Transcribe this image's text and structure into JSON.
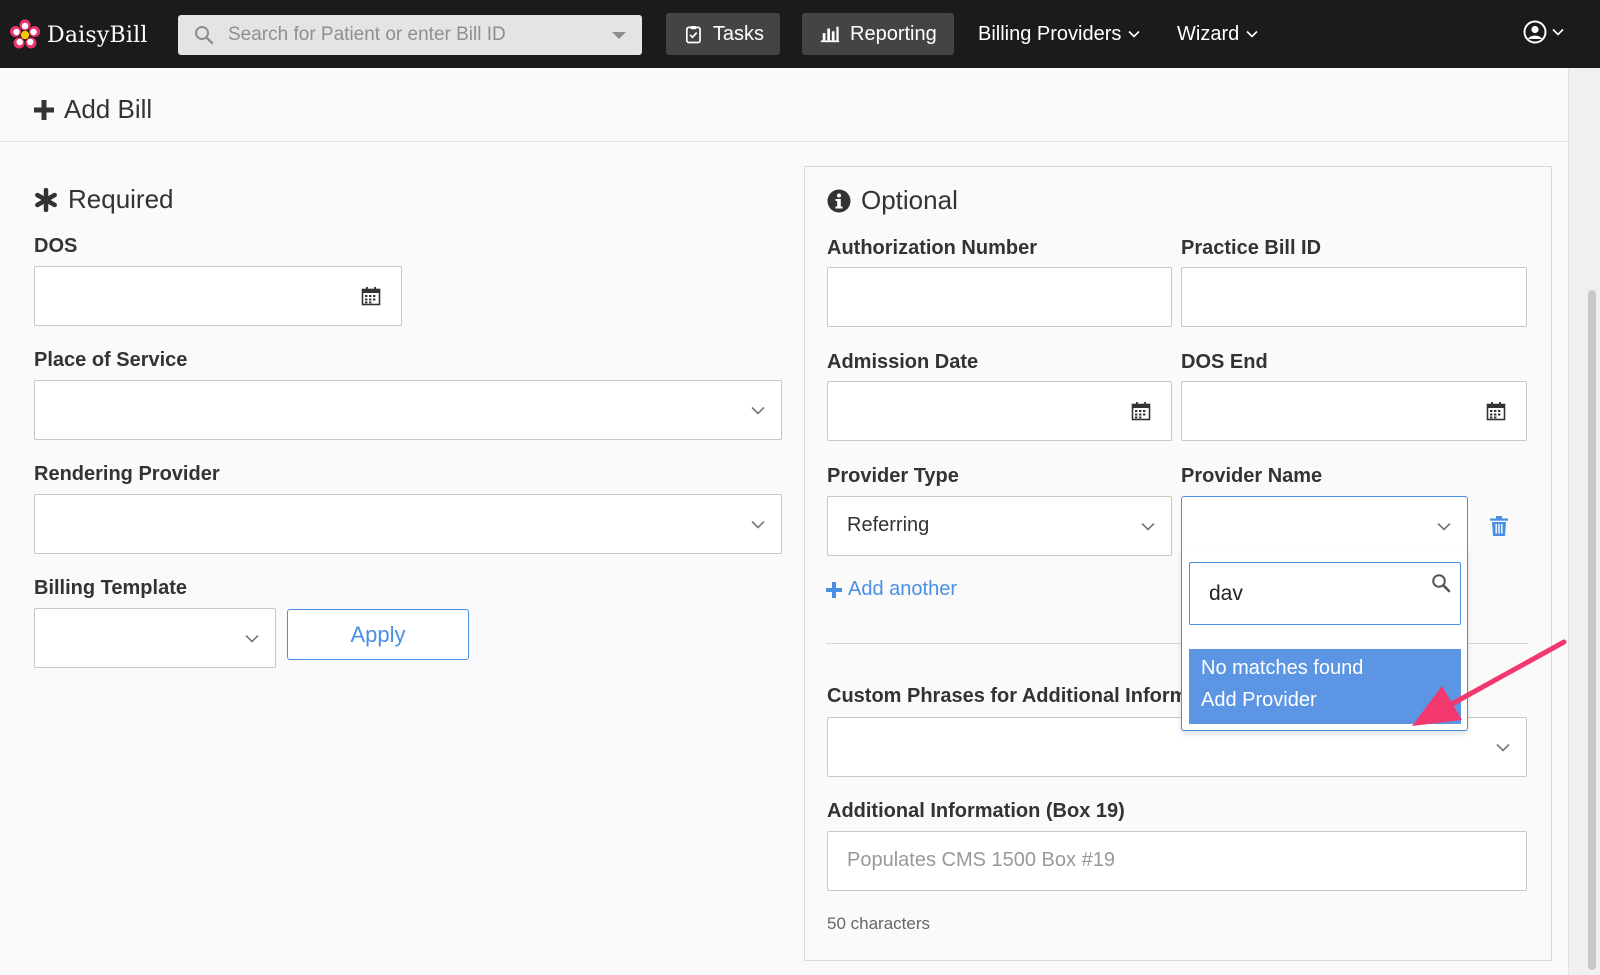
{
  "app": {
    "name": "DaisyBill"
  },
  "nav": {
    "search_placeholder": "Search for Patient or enter Bill ID",
    "tasks_label": "Tasks",
    "reporting_label": "Reporting",
    "billing_providers_label": "Billing Providers",
    "wizard_label": "Wizard"
  },
  "page": {
    "title": "Add Bill"
  },
  "required": {
    "title": "Required",
    "dos_label": "DOS",
    "place_of_service_label": "Place of Service",
    "rendering_provider_label": "Rendering Provider",
    "billing_template_label": "Billing Template",
    "apply_label": "Apply"
  },
  "optional": {
    "title": "Optional",
    "authorization_number_label": "Authorization Number",
    "practice_bill_id_label": "Practice Bill ID",
    "admission_date_label": "Admission Date",
    "dos_end_label": "DOS End",
    "provider_type_label": "Provider Type",
    "provider_type_value": "Referring",
    "provider_name_label": "Provider Name",
    "add_another_label": "Add another",
    "custom_phrases_label": "Custom Phrases for Additional Inform",
    "additional_info_label": "Additional Information (Box 19)",
    "additional_info_placeholder": "Populates CMS 1500 Box #19",
    "char_count": "50 characters"
  },
  "provider_dropdown": {
    "search_value": "dav",
    "no_matches": "No matches found",
    "add_provider": "Add Provider"
  },
  "colors": {
    "navbar_bg": "#1b1b1b",
    "accent_blue": "#4a90e2",
    "highlight_blue": "#5b95e3",
    "arrow_pink": "#f2386f"
  },
  "icons": {
    "logo": "daisy-flower-icon",
    "search": "search-icon",
    "tasks": "clipboard-check-icon",
    "reporting": "bar-chart-icon",
    "user": "user-circle-icon",
    "calendar": "calendar-icon",
    "required": "asterisk-icon",
    "optional": "info-circle-icon",
    "delete": "trash-icon"
  }
}
